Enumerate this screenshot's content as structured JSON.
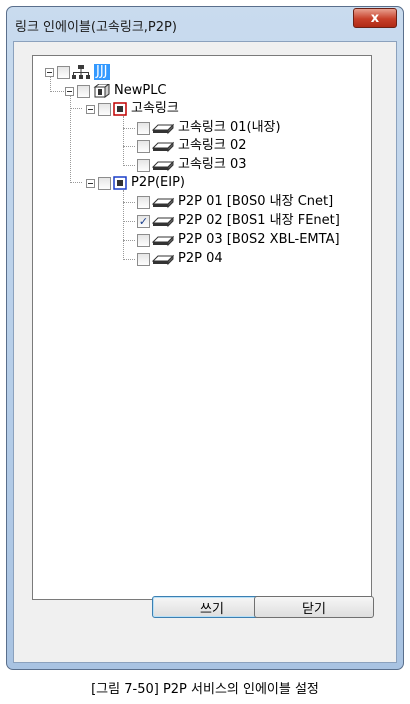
{
  "window": {
    "title": "링크 인에이블(고속링크,P2P)",
    "close_glyph": "x"
  },
  "tree": {
    "root": "JJJ",
    "plc": "NewPLC",
    "highspeed": {
      "label": "고속링크",
      "items": [
        "고속링크 01(내장)",
        "고속링크 02",
        "고속링크 03"
      ]
    },
    "p2p": {
      "label": "P2P(EIP)",
      "items": [
        {
          "label": "P2P 01 [B0S0 내장 Cnet]",
          "checked": false
        },
        {
          "label": "P2P 02 [B0S1 내장 FEnet]",
          "checked": true
        },
        {
          "label": "P2P 03 [B0S2 XBL-EMTA]",
          "checked": false
        },
        {
          "label": "P2P 04",
          "checked": false
        }
      ]
    },
    "check_mark": "✓"
  },
  "buttons": {
    "write": "쓰기",
    "close": "닫기"
  },
  "caption": "[그림 7-50] P2P 서비스의 인에이블 설정"
}
